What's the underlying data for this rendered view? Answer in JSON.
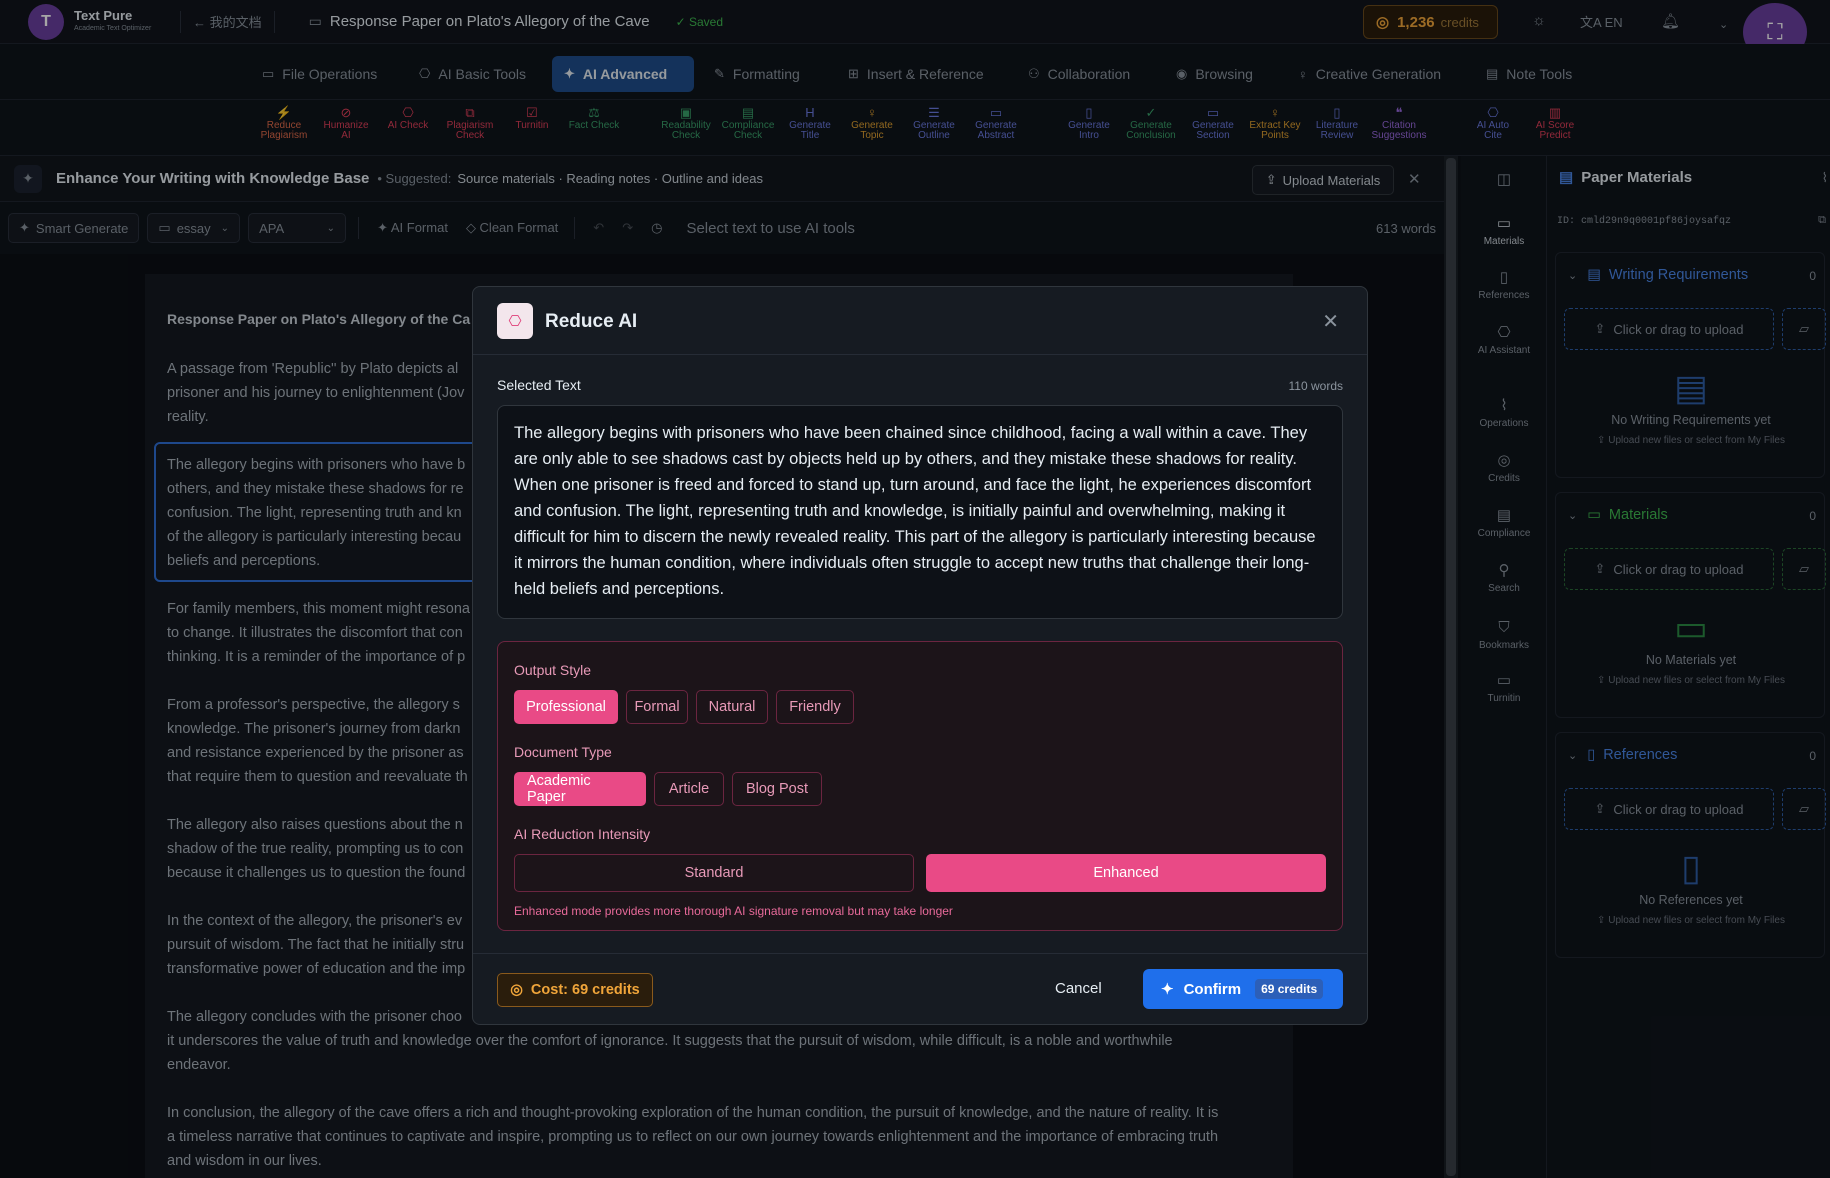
{
  "app": {
    "name": "Text Pure",
    "tagline": "Academic Text Optimizer"
  },
  "topbar": {
    "back_label": "← 我的文档",
    "doc_title": "Response Paper on Plato's Allegory of the Cave",
    "saved": "✓ Saved",
    "credits_value": "1,236",
    "credits_label": "credits",
    "lang": "EN"
  },
  "menu": [
    {
      "label": "File Operations",
      "icon": "file-icon"
    },
    {
      "label": "AI Basic Tools",
      "icon": "robot-icon"
    },
    {
      "label": "AI Advanced",
      "icon": "sparkle-icon",
      "active": true
    },
    {
      "label": "Formatting",
      "icon": "brush-icon"
    },
    {
      "label": "Insert & Reference",
      "icon": "insert-icon"
    },
    {
      "label": "Collaboration",
      "icon": "users-icon"
    },
    {
      "label": "Browsing",
      "icon": "eye-icon"
    },
    {
      "label": "Creative Generation",
      "icon": "bulb-icon"
    },
    {
      "label": "Note Tools",
      "icon": "note-icon"
    }
  ],
  "tools": [
    {
      "l1": "Reduce",
      "l2": "Plagiarism"
    },
    {
      "l1": "Humanize",
      "l2": "AI"
    },
    {
      "l1": "AI Check",
      "l2": ""
    },
    {
      "l1": "Plagiarism",
      "l2": "Check"
    },
    {
      "l1": "Turnitin",
      "l2": ""
    },
    {
      "l1": "Fact Check",
      "l2": ""
    },
    {
      "l1": "Readability",
      "l2": "Check"
    },
    {
      "l1": "Compliance",
      "l2": "Check"
    },
    {
      "l1": "Generate",
      "l2": "Title"
    },
    {
      "l1": "Generate",
      "l2": "Topic"
    },
    {
      "l1": "Generate",
      "l2": "Outline"
    },
    {
      "l1": "Generate",
      "l2": "Abstract"
    },
    {
      "l1": "Generate",
      "l2": "Intro"
    },
    {
      "l1": "Generate",
      "l2": "Conclusion"
    },
    {
      "l1": "Generate",
      "l2": "Section"
    },
    {
      "l1": "Extract Key",
      "l2": "Points"
    },
    {
      "l1": "Literature",
      "l2": "Review"
    },
    {
      "l1": "Citation",
      "l2": "Suggestions"
    },
    {
      "l1": "AI Auto",
      "l2": "Cite"
    },
    {
      "l1": "AI Score",
      "l2": "Predict"
    }
  ],
  "kb": {
    "title": "Enhance Your Writing with Knowledge Base",
    "suggested_label": "• Suggested:",
    "suggested": "Source materials · Reading notes · Outline and ideas",
    "upload": "Upload Materials"
  },
  "editor_bar": {
    "smart_generate": "Smart Generate",
    "type": "essay",
    "style": "APA",
    "ai_format": "AI Format",
    "clean_format": "Clean Format",
    "hint": "Select text to use AI tools",
    "word_count": "613 words"
  },
  "doc": {
    "title": "Response Paper on Plato's Allegory of the Ca",
    "paras": [
      "A passage from 'Republic'' by Plato depicts al",
      "prisoner and his journey to enlightenment (Jov",
      "reality.",
      "The allegory begins with prisoners who have b",
      "others, and they mistake these shadows for re",
      "confusion. The light, representing truth and kn",
      "of the allegory is particularly interesting becau",
      "beliefs and perceptions.",
      "For family members, this moment might resona",
      "to change. It illustrates the discomfort that con",
      "thinking. It is a reminder of the importance of p",
      "From a professor's perspective, the allegory s",
      "knowledge. The prisoner's journey from darkn",
      "and resistance experienced by the prisoner as",
      "that require them to question and reevaluate th",
      "The allegory also raises questions about the n",
      "shadow of the true reality, prompting us to con",
      "because it challenges us to question the found",
      "In the context of the allegory, the prisoner's ev",
      "pursuit of wisdom. The fact that he initially stru",
      "transformative power of education and the imp",
      "The allegory concludes with the prisoner choo",
      "it underscores the value of truth and knowledge over the comfort of ignorance. It suggests that the pursuit of wisdom, while difficult, is a noble and worthwhile",
      "endeavor.",
      "In conclusion, the allegory of the cave offers a rich and thought-provoking exploration of the human condition, the pursuit of knowledge, and the nature of reality. It is",
      "a timeless narrative that continues to captivate and inspire, prompting us to reflect on our own journey towards enlightenment and the importance of embracing truth",
      "and wisdom in our lives."
    ]
  },
  "sidebar": [
    {
      "label": "Materials",
      "icon": "doc-icon",
      "active": true
    },
    {
      "label": "References",
      "icon": "book-icon"
    },
    {
      "label": "AI Assistant",
      "icon": "robot-icon"
    },
    {
      "label": "Operations",
      "icon": "activity-icon"
    },
    {
      "label": "Credits",
      "icon": "coins-icon"
    },
    {
      "label": "Compliance",
      "icon": "file-check-icon"
    },
    {
      "label": "Search",
      "icon": "search-icon"
    },
    {
      "label": "Bookmarks",
      "icon": "bookmark-icon"
    },
    {
      "label": "Turnitin",
      "icon": "turnitin-icon"
    }
  ],
  "right_panel": {
    "title": "Paper Materials",
    "id": "ID: cmld29n9q0001pf86joysafqz",
    "sections": [
      {
        "title": "Writing Requirements",
        "count": "0",
        "drop": "Click or drag to upload",
        "empty": "No Writing Requirements yet",
        "hint": "Upload new files or select from My Files"
      },
      {
        "title": "Materials",
        "count": "0",
        "drop": "Click or drag to upload",
        "empty": "No Materials yet",
        "hint": "Upload new files or select from My Files"
      },
      {
        "title": "References",
        "count": "0",
        "drop": "Click or drag to upload",
        "empty": "No References yet",
        "hint": "Upload new files or select from My Files"
      }
    ]
  },
  "modal": {
    "title": "Reduce AI",
    "selected_label": "Selected Text",
    "word_count": "110 words",
    "selected_text": "The allegory begins with prisoners who have been chained since childhood, facing a wall within a cave. They are only able to see shadows cast by objects held up by others, and they mistake these shadows for reality. When one prisoner is freed and forced to stand up, turn around, and face the light, he experiences discomfort and confusion. The light, representing truth and knowledge, is initially painful and overwhelming, making it difficult for him to discern the newly revealed reality. This part of the allegory is particularly interesting because it mirrors the human condition, where individuals often struggle to accept new truths that challenge their long-held beliefs and perceptions.",
    "output_style_label": "Output Style",
    "output_styles": [
      "Professional",
      "Formal",
      "Natural",
      "Friendly"
    ],
    "doc_type_label": "Document Type",
    "doc_types": [
      "Academic Paper",
      "Article",
      "Blog Post"
    ],
    "intensity_label": "AI Reduction Intensity",
    "intensity_standard": "Standard",
    "intensity_enhanced": "Enhanced",
    "intensity_note": "Enhanced mode provides more thorough AI signature removal but may take longer",
    "cost": "Cost: 69 credits",
    "cancel": "Cancel",
    "confirm": "Confirm",
    "confirm_badge": "69 credits"
  },
  "colors": {
    "accent": "#e94a86",
    "primary": "#1f6feb",
    "credits": "#f0a53a"
  }
}
